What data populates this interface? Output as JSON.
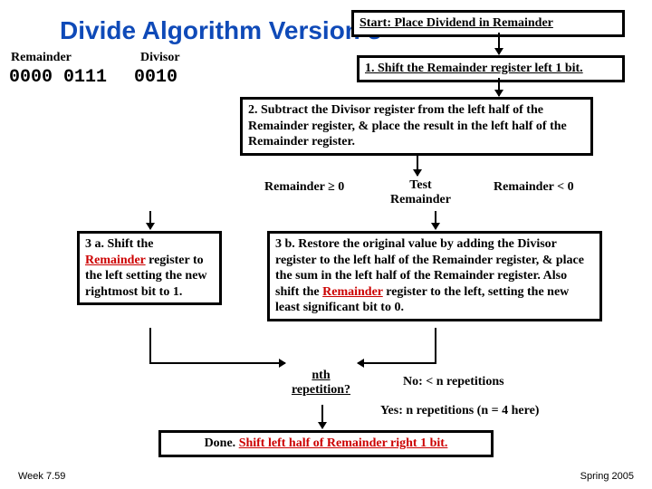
{
  "title": "Divide Algorithm Version 3",
  "initial": {
    "remainder_label": "Remainder",
    "divisor_label": "Divisor",
    "remainder_value": "0000 0111",
    "divisor_value": "0010"
  },
  "start_box": "Start: Place Dividend in Remainder",
  "step1": "1. Shift the Remainder register left 1 bit.",
  "step2": "2. Subtract the Divisor register from the left half of the Remainder register, & place the result in the left half of the Remainder register.",
  "test_left_label": "Remainder ≥ 0",
  "test_diamond_line1": "Test",
  "test_diamond_line2": "Remainder",
  "test_right_label": "Remainder < 0",
  "step3a_pre": "3 a. Shift the ",
  "step3a_rem": "Remainder",
  "step3a_post": " register to the left setting the new rightmost  bit to 1.",
  "step3b_pre": "3 b. Restore the original value by adding the Divisor register to the left half of the Remainder register, & place the sum in the left half of the Remainder register. Also shift the ",
  "step3b_rem": "Remainder",
  "step3b_post": " register to the left, setting the new least significant bit to 0.",
  "nth_line1": "nth",
  "nth_line2": "repetition?",
  "no_label": "No: < n repetitions",
  "yes_label": "Yes: n repetitions (n = 4 here)",
  "done_pre": "Done. ",
  "done_red": "Shift left half of Remainder right 1 bit.",
  "footer_left": "Week 7.59",
  "footer_right": "Spring 2005"
}
